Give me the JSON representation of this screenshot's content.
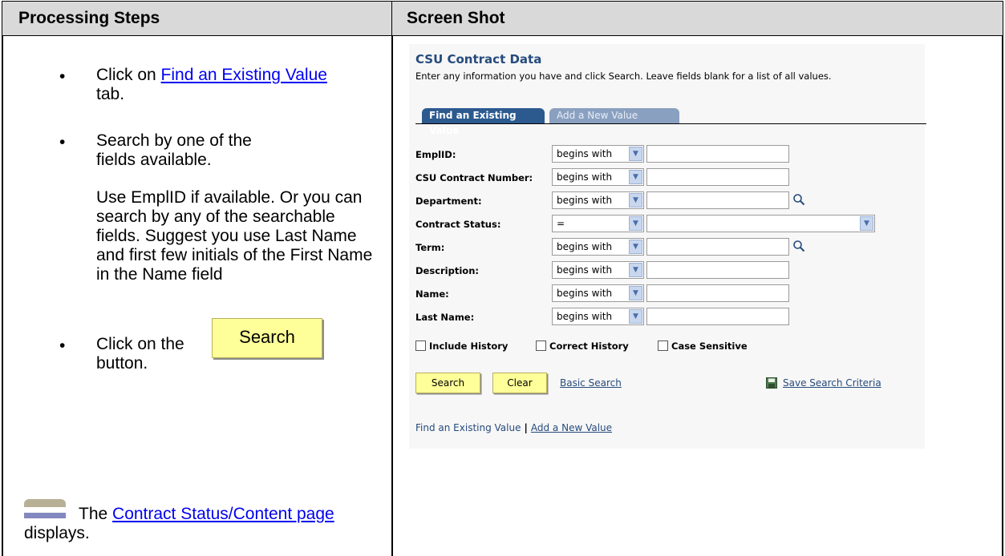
{
  "headers": {
    "left": "Processing Steps",
    "right": "Screen Shot"
  },
  "steps": {
    "step1_prefix": "Click on ",
    "step1_link": "Find an Existing Value",
    "step1_suffix": "tab.",
    "step2_line1": "Search by one of the fields available.",
    "step2_para": "Use EmplID if available.  Or you can search by any of the searchable fields.  Suggest you use Last Name and first few initials of the First Name in the Name field",
    "step3_prefix": "Click on the",
    "step3_suffix": "button.",
    "search_button_image": "Search",
    "result_prefix": "The ",
    "result_link": "Contract Status/Content page",
    "result_suffix": "displays.",
    "bullet": "•"
  },
  "page": {
    "title": "CSU Contract Data",
    "instructions": "Enter any information you have and click Search. Leave fields blank for a list of all values.",
    "tabs": [
      {
        "label": "Find an Existing Value",
        "active": true
      },
      {
        "label": "Add a New Value",
        "active": false
      }
    ],
    "fields": [
      {
        "label": "EmplID:",
        "operator": "begins with",
        "value": ""
      },
      {
        "label": "CSU Contract Number:",
        "operator": "begins with",
        "value": ""
      },
      {
        "label": "Department:",
        "operator": "begins with",
        "value": ""
      },
      {
        "label": "Contract Status:",
        "operator": "=",
        "value": ""
      },
      {
        "label": "Term:",
        "operator": "begins with",
        "value": ""
      },
      {
        "label": "Description:",
        "operator": "begins with",
        "value": ""
      },
      {
        "label": "Name:",
        "operator": "begins with",
        "value": ""
      },
      {
        "label": "Last Name:",
        "operator": "begins with",
        "value": ""
      }
    ],
    "checkboxes": [
      {
        "label": "Include History",
        "checked": false
      },
      {
        "label": "Correct History",
        "checked": false
      },
      {
        "label": "Case Sensitive",
        "checked": false
      }
    ],
    "buttons": {
      "search": "Search",
      "clear": "Clear"
    },
    "links": {
      "basic_search": "Basic Search",
      "save_search": "Save Search Criteria"
    },
    "bottom_links": {
      "find": "Find an Existing Value",
      "separator": "|",
      "add": "Add a New Value"
    }
  },
  "colors": {
    "title": "#264b7d",
    "tab_active": "#2c5a8f",
    "button_bg": "#ffff99",
    "link": "#0000ee"
  },
  "icons": {
    "lookup": "magnifier-icon",
    "save": "floppy-disk-icon",
    "dropdown": "chevron-down-icon"
  }
}
